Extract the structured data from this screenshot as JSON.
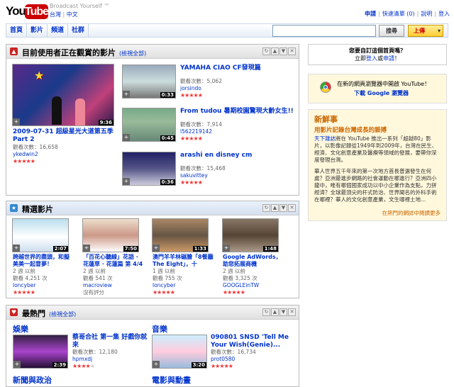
{
  "header": {
    "logo_you": "You",
    "logo_tube": "Tube",
    "tagline": "Broadcast Yourself ™",
    "locale_country": "台灣",
    "locale_lang": "中文",
    "links": [
      "申請",
      "快速清單 (0)",
      "說明",
      "登入"
    ]
  },
  "nav": {
    "items": [
      "首頁",
      "影片",
      "頻道",
      "社群"
    ],
    "search_button": "搜尋",
    "upload_button": "上傳"
  },
  "watching": {
    "title": "目前使用者正在觀賞的影片",
    "all_link": "(檢視全部)",
    "main": {
      "title": "2009-07-31 超級星光大道第五季 Part 2",
      "views": "觀看次數：16,658",
      "user": "ykedwin2",
      "duration": "9:36",
      "rating": 5
    },
    "videos": [
      {
        "title": "YAMAHA CIAO CF發現篇",
        "views": "觀看次數：5,062",
        "user": "jorsindo",
        "duration": "0:33",
        "rating": 5
      },
      {
        "title": "From tudou 暑期校園驚現大齡女生!!",
        "views": "觀看次數：7,914",
        "user": "l562219142",
        "duration": "0:45",
        "rating": 5
      },
      {
        "title": "arashi en disney cm",
        "views": "觀看次數：15,468",
        "user": "sakuvittey",
        "duration": "0:36",
        "rating": 5
      }
    ]
  },
  "featured": {
    "title": "精選影片",
    "videos": [
      {
        "title": "跨越世界的盡頭，和擬美美一起冒夢！",
        "age": "2 週 以前",
        "views": "觀看 4,251 次",
        "user": "loncyber",
        "duration": "2:07",
        "rating": 5
      },
      {
        "title": "「百花心聽線」花語 · 花蓮草 · 花蓮篇 第 4/4",
        "age": "2 週 以前",
        "views": "觀看 541 次",
        "user": "macroview",
        "duration": "7:50",
        "rating": 0,
        "no_rating": "沒有評分"
      },
      {
        "title": "澳門羊羊林碾膾「8餐廳 The Eight」，十",
        "age": "1 週 以前",
        "views": "觀看 755 次",
        "user": "loncyber",
        "duration": "1:33",
        "rating": 5
      },
      {
        "title": "Google AdWords，助您拓展商機",
        "age": "2 週 以前",
        "views": "觀看 3,325 次",
        "user": "GOOGLEinTW",
        "duration": "1:48",
        "rating": 5
      }
    ]
  },
  "popular": {
    "title": "最熱門",
    "all_link": "(檢視全部)",
    "categories": [
      {
        "name": "娛樂",
        "video": {
          "title": "蔡哥合社 第一集 好戲你就來",
          "views": "觀看次數：12,180",
          "user": "hpmxdj",
          "duration": "2:39",
          "rating": 4
        }
      },
      {
        "name": "音樂",
        "video": {
          "title": "090801 SNSD 'Tell Me Your Wish(Genie)...",
          "views": "觀看次數：16,734",
          "user": "prot0580",
          "duration": "3:20",
          "rating": 5
        }
      }
    ],
    "more_categories": [
      "新聞與政治",
      "電影與動畫"
    ]
  },
  "sidebar": {
    "custom": {
      "line1": "您要自訂這個首頁嗎？",
      "line2_pre": "立即",
      "signup": "登入",
      "or": "或",
      "register": "申請",
      "end": "！"
    },
    "browser": {
      "line1": "在新的網頁瀏覽器中開啟 YouTube！",
      "line2": "下載 Google 瀏覽器"
    },
    "news": {
      "heading": "新鮮事",
      "subheading": "用影片記錄台灣成長的脈搏",
      "para1_link": "天下雜誌",
      "para1": "將在 YouTube 推出一系列「超越80」影片，以影像記錄從1949年到2009年，台灣在民生、經濟、文化創意產業及醫療等領域的發展，要帶你深度發現台灣。",
      "para2": "華人世界五千年來的第一次地方首長普選發生在何處？亞洲最進步網路的社會運動在哪進行？亞洲四小龍中，唯有哪個國家成功以中小企業作為支點，力拼經濟？全球最頂尖的杆式防治、世界聞名的外科手術在哪裡？華人的文化創意產業，文生哪裡土地...",
      "more": "在熱門的網誌中閱讀更多"
    }
  }
}
